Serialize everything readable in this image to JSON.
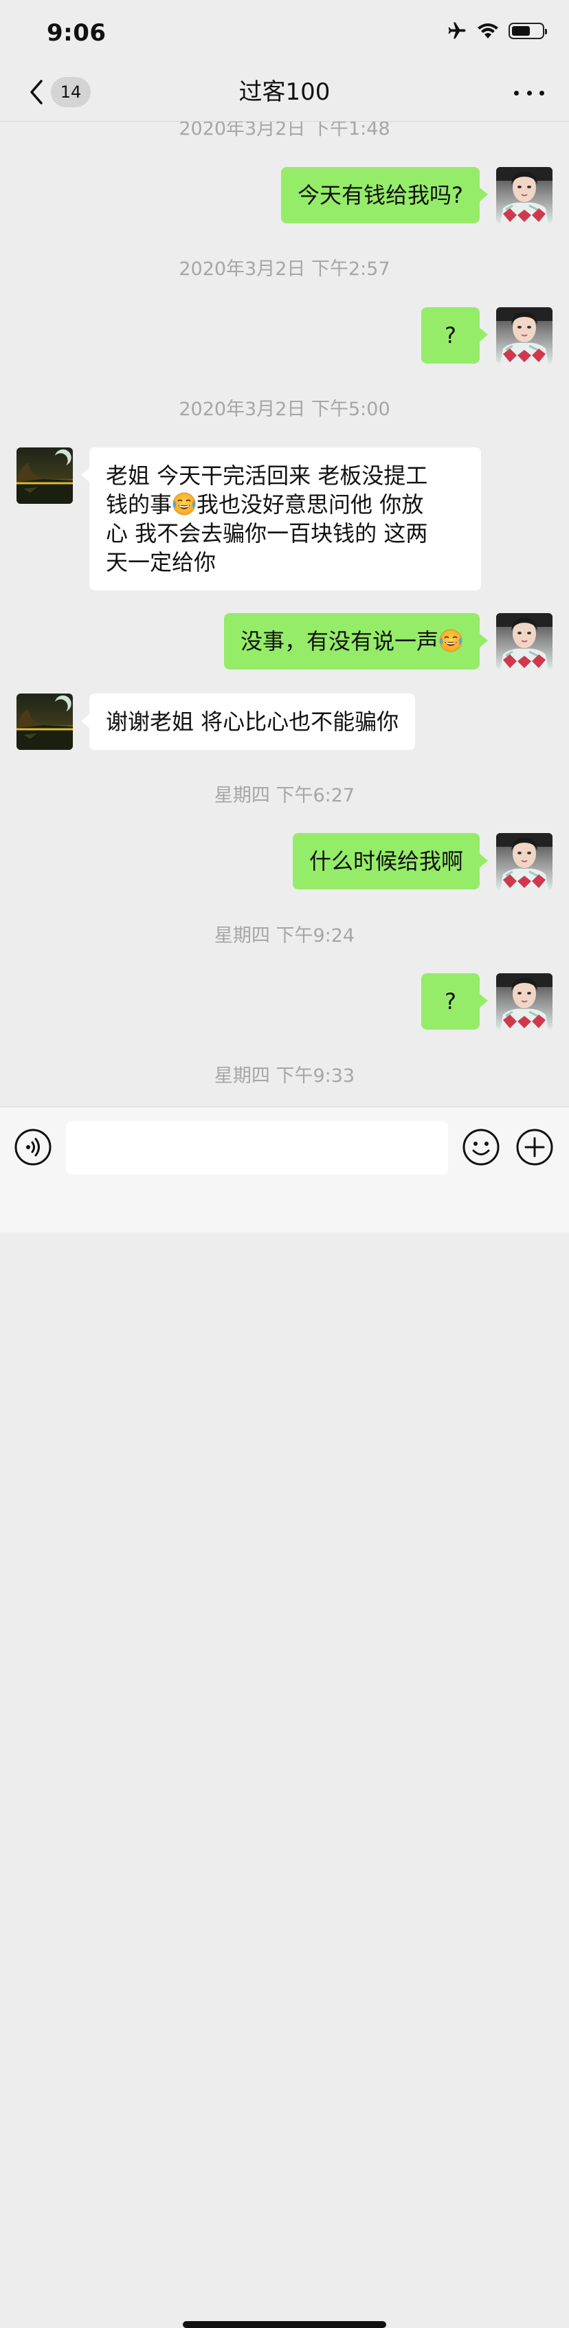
{
  "status_bar": {
    "time": "9:06",
    "icons": [
      "airplane-icon",
      "wifi-icon",
      "battery-icon"
    ],
    "battery_level": 0.55
  },
  "nav": {
    "back_badge": "14",
    "title": "过客100",
    "more_icon": "more-icon"
  },
  "colors": {
    "background": "#ededed",
    "outgoing_bubble": "#95ec69",
    "incoming_bubble": "#ffffff",
    "timestamp": "#a6a6a6"
  },
  "messages": [
    {
      "type": "timestamp",
      "text": "2020年3月2日 下午1:48"
    },
    {
      "type": "outgoing",
      "text": "今天有钱给我吗?"
    },
    {
      "type": "timestamp",
      "text": "2020年3月2日 下午2:57"
    },
    {
      "type": "outgoing",
      "text": "?"
    },
    {
      "type": "timestamp",
      "text": "2020年3月2日 下午5:00"
    },
    {
      "type": "incoming",
      "lines": [
        "老姐  今天干完活回来  老板没提工",
        "钱的事",
        "我也没好意思问他   你放",
        "心 我不会去骗你一百块钱的  这两",
        "天一定给你"
      ],
      "emoji": "crying-laughing-emoji"
    },
    {
      "type": "outgoing",
      "text": "没事，有没有说一声",
      "emoji": "crying-laughing-emoji"
    },
    {
      "type": "incoming",
      "text": "谢谢老姐  将心比心也不能骗你"
    },
    {
      "type": "timestamp",
      "text": "星期四 下午6:27"
    },
    {
      "type": "outgoing",
      "text": "什么时候给我啊"
    },
    {
      "type": "timestamp",
      "text": "星期四 下午9:24"
    },
    {
      "type": "outgoing",
      "text": "?"
    },
    {
      "type": "timestamp",
      "text": "星期四 下午9:33"
    }
  ],
  "input_bar": {
    "voice_icon": "voice-icon",
    "input_value": "",
    "emoji_icon": "emoji-icon",
    "plus_icon": "plus-icon"
  }
}
